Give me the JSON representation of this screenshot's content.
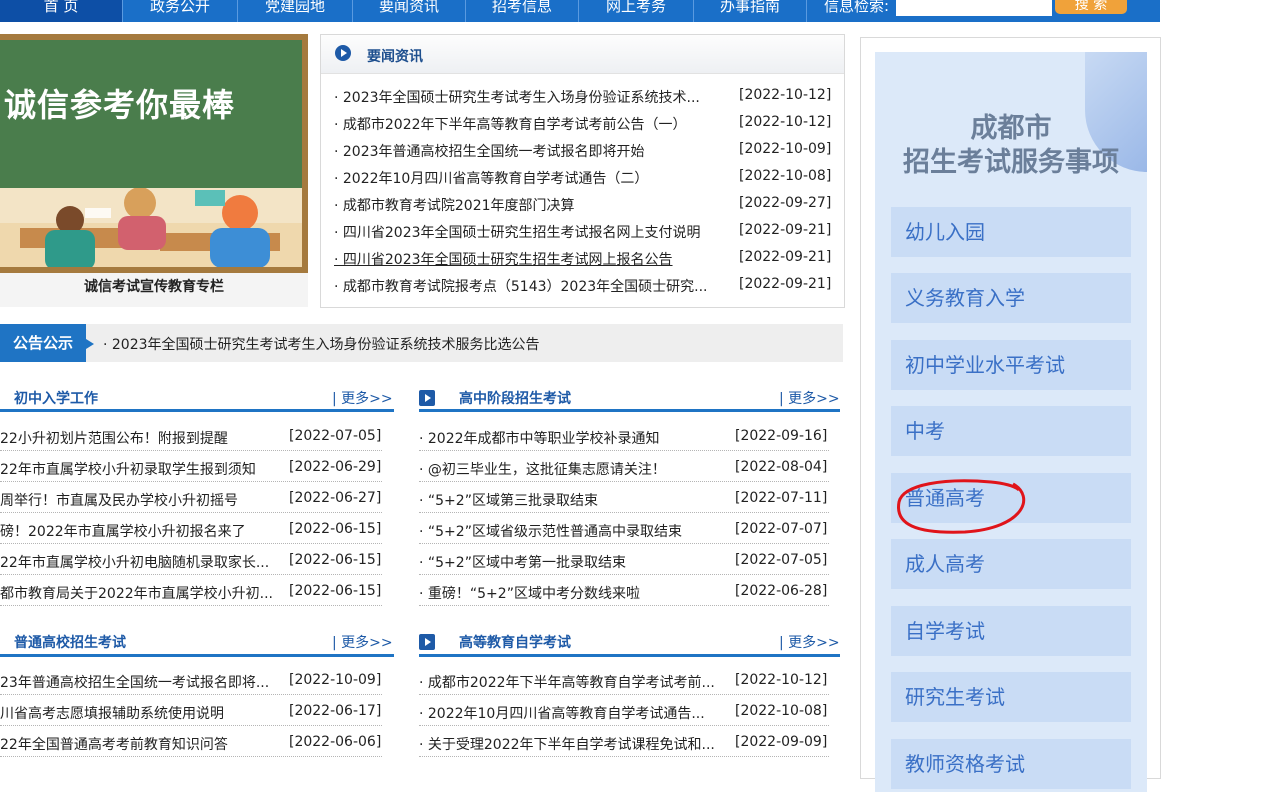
{
  "nav": {
    "items": [
      "首 页",
      "政务公开",
      "党建园地",
      "要闻资讯",
      "招考信息",
      "网上考务",
      "办事指南"
    ],
    "search_label": "信息检索:",
    "search_placeholder": "",
    "search_button": "搜 索"
  },
  "banner": {
    "slogan": "诚信参考你最棒",
    "caption": "诚信考试宣传教育专栏"
  },
  "news": {
    "title": "要闻资讯",
    "items": [
      {
        "title": "· 2023年全国硕士研究生考试考生入场身份验证系统技术...",
        "date": "[2022-10-12]"
      },
      {
        "title": "· 成都市2022年下半年高等教育自学考试考前公告（一）",
        "date": "[2022-10-12]"
      },
      {
        "title": "· 2023年普通高校招生全国统一考试报名即将开始",
        "date": "[2022-10-09]"
      },
      {
        "title": "· 2022年10月四川省高等教育自学考试通告（二）",
        "date": "[2022-10-08]"
      },
      {
        "title": "· 成都市教育考试院2021年度部门决算",
        "date": "[2022-09-27]"
      },
      {
        "title": "· 四川省2023年全国硕士研究生招生考试报名网上支付说明",
        "date": "[2022-09-21]"
      },
      {
        "title": "· 四川省2023年全国硕士研究生招生考试网上报名公告",
        "date": "[2022-09-21]"
      },
      {
        "title": "· 成都市教育考试院报考点（5143）2023年全国硕士研究...",
        "date": "[2022-09-21]"
      }
    ]
  },
  "notice": {
    "label": "公告公示",
    "text": "· 2023年全国硕士研究生考试考生入场身份验证系统技术服务比选公告"
  },
  "sections": {
    "junior": {
      "title": "初中入学工作",
      "more": "| 更多>>",
      "items": [
        {
          "title": "22小升初划片范围公布！附报到提醒",
          "date": "[2022-07-05]"
        },
        {
          "title": "22年市直属学校小升初录取学生报到须知",
          "date": "[2022-06-29]"
        },
        {
          "title": "周举行！市直属及民办学校小升初摇号",
          "date": "[2022-06-27]"
        },
        {
          "title": "磅！2022年市直属学校小升初报名来了",
          "date": "[2022-06-15]"
        },
        {
          "title": "22年市直属学校小升初电脑随机录取家长...",
          "date": "[2022-06-15]"
        },
        {
          "title": "都市教育局关于2022年市直属学校小升初...",
          "date": "[2022-06-15]"
        }
      ]
    },
    "highschool": {
      "title": "高中阶段招生考试",
      "more": "| 更多>>",
      "items": [
        {
          "title": "· 2022年成都市中等职业学校补录通知",
          "date": "[2022-09-16]"
        },
        {
          "title": "· @初三毕业生，这批征集志愿请关注！",
          "date": "[2022-08-04]"
        },
        {
          "title": "· “5+2”区域第三批录取结束",
          "date": "[2022-07-11]"
        },
        {
          "title": "· “5+2”区域省级示范性普通高中录取结束",
          "date": "[2022-07-07]"
        },
        {
          "title": "· “5+2”区域中考第一批录取结束",
          "date": "[2022-07-05]"
        },
        {
          "title": "· 重磅！“5+2”区域中考分数线来啦",
          "date": "[2022-06-28]"
        }
      ]
    },
    "college": {
      "title": "普通高校招生考试",
      "more": "| 更多>>",
      "items": [
        {
          "title": "23年普通高校招生全国统一考试报名即将...",
          "date": "[2022-10-09]"
        },
        {
          "title": "川省高考志愿填报辅助系统使用说明",
          "date": "[2022-06-17]"
        },
        {
          "title": "22年全国普通高考考前教育知识问答",
          "date": "[2022-06-06]"
        }
      ]
    },
    "selfstudy": {
      "title": "高等教育自学考试",
      "more": "| 更多>>",
      "items": [
        {
          "title": "· 成都市2022年下半年高等教育自学考试考前...",
          "date": "[2022-10-12]"
        },
        {
          "title": "· 2022年10月四川省高等教育自学考试通告...",
          "date": "[2022-10-08]"
        },
        {
          "title": "· 关于受理2022年下半年自学考试课程免试和...",
          "date": "[2022-09-09]"
        }
      ]
    }
  },
  "right_panel": {
    "heading_line1": "成都市",
    "heading_line2": "招生考试服务事项",
    "services": [
      "幼儿入园",
      "义务教育入学",
      "初中学业水平考试",
      "中考",
      "普通高考",
      "成人高考",
      "自学考试",
      "研究生考试",
      "教师资格考试"
    ]
  },
  "colors": {
    "nav_bg": "#1a6fc8",
    "accent_blue": "#1f74c4",
    "annotation_red": "#e0141a",
    "service_bg": "#c9dcf5"
  }
}
